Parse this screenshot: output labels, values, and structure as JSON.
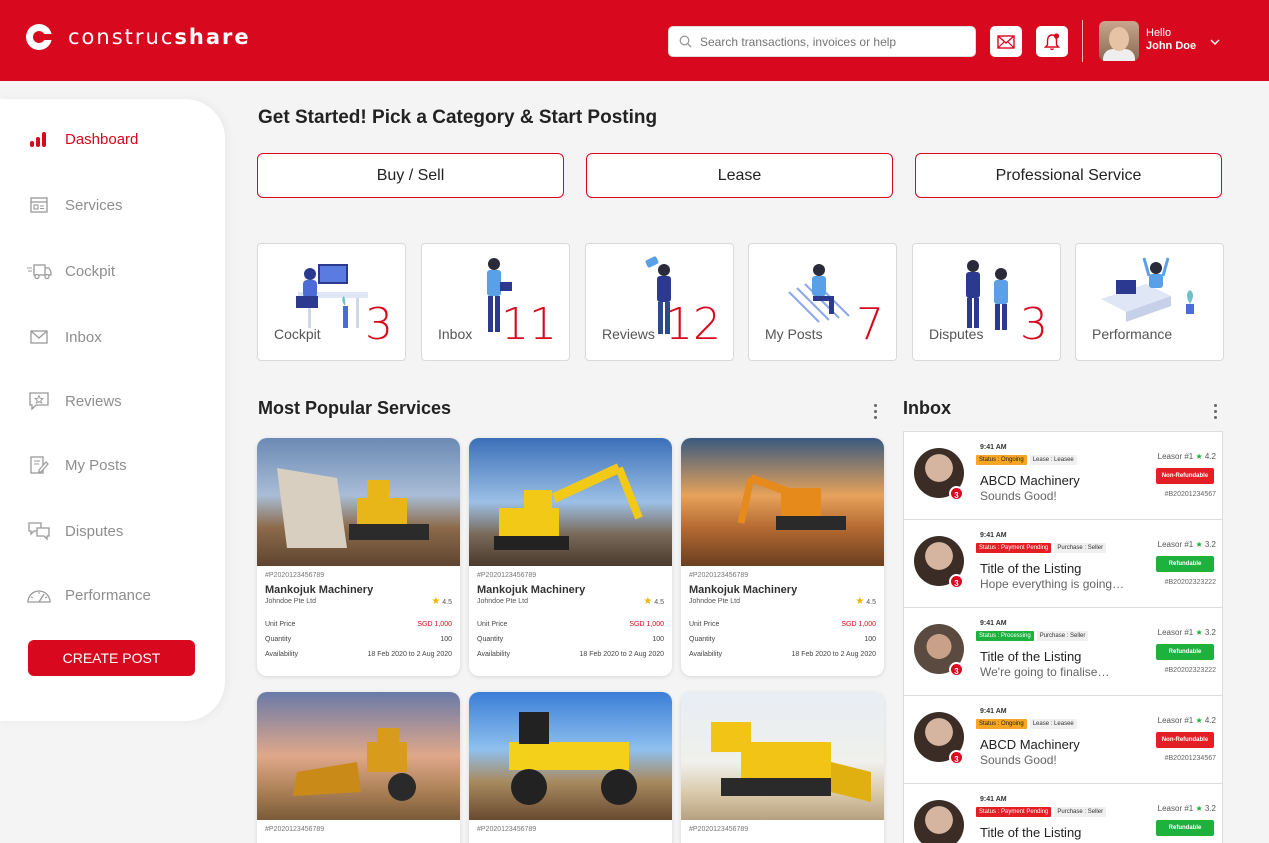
{
  "header": {
    "brand_light": "construc",
    "brand_bold": "share",
    "search_placeholder": "Search transactions, invoices or help",
    "greeting": "Hello",
    "user_name": "John Doe"
  },
  "sidebar": {
    "items": [
      {
        "label": "Dashboard",
        "icon": "bar-chart-icon"
      },
      {
        "label": "Services",
        "icon": "services-icon"
      },
      {
        "label": "Cockpit",
        "icon": "truck-icon"
      },
      {
        "label": "Inbox",
        "icon": "mail-icon"
      },
      {
        "label": "Reviews",
        "icon": "star-chat-icon"
      },
      {
        "label": "My Posts",
        "icon": "edit-icon"
      },
      {
        "label": "Disputes",
        "icon": "chat-bubbles-icon"
      },
      {
        "label": "Performance",
        "icon": "gauge-icon"
      }
    ],
    "create_post": "CREATE POST"
  },
  "main": {
    "title": "Get Started! Pick a Category & Start Posting",
    "categories": [
      "Buy / Sell",
      "Lease",
      "Professional Service"
    ],
    "tiles": [
      {
        "label": "Cockpit",
        "count": "3"
      },
      {
        "label": "Inbox",
        "count": "11"
      },
      {
        "label": "Reviews",
        "count": "12"
      },
      {
        "label": "My Posts",
        "count": "7"
      },
      {
        "label": "Disputes",
        "count": "3"
      },
      {
        "label": "Performance",
        "count": ""
      }
    ],
    "popular_title": "Most Popular Services",
    "inbox_title": "Inbox"
  },
  "services": {
    "cards": [
      {
        "id": "#P2020123456789",
        "title": "Mankojuk Machinery",
        "company": "Johndoe Pte Ltd",
        "rating": "4.5",
        "unit_price_label": "Unit Price",
        "unit_price": "SGD 1,000",
        "quantity_label": "Quantity",
        "quantity": "100",
        "availability_label": "Availability",
        "availability": "18 Feb 2020 to 2 Aug 2020"
      },
      {
        "id": "#P2020123456789",
        "title": "Mankojuk Machinery",
        "company": "Johndoe Pte Ltd",
        "rating": "4.5",
        "unit_price_label": "Unit Price",
        "unit_price": "SGD 1,000",
        "quantity_label": "Quantity",
        "quantity": "100",
        "availability_label": "Availability",
        "availability": "18 Feb 2020 to 2 Aug 2020"
      },
      {
        "id": "#P2020123456789",
        "title": "Mankojuk Machinery",
        "company": "Johndoe Pte Ltd",
        "rating": "4.5",
        "unit_price_label": "Unit Price",
        "unit_price": "SGD 1,000",
        "quantity_label": "Quantity",
        "quantity": "100",
        "availability_label": "Availability",
        "availability": "18 Feb 2020 to 2 Aug 2020"
      }
    ],
    "row2_ids": [
      "#P2020123456789",
      "#P2020123456789",
      "#P2020123456789"
    ]
  },
  "inbox": {
    "messages": [
      {
        "time": "9:41 AM",
        "tag1": "Status : Ongoing",
        "tag1_color": "orange",
        "tag2": "Lease : Leasee",
        "title": "ABCD Machinery",
        "text": "Sounds Good!",
        "lessor": "Leasor #1",
        "rating": "4.2",
        "status": "Non-Refundable",
        "status_color": "red",
        "ref": "#B20201234567",
        "badge": "3"
      },
      {
        "time": "9:41 AM",
        "tag1": "Status : Payment Pending",
        "tag1_color": "red",
        "tag2": "Purchase : Seller",
        "title": "Title of the Listing",
        "text": "Hope everything is going…",
        "lessor": "Leasor #1",
        "rating": "3.2",
        "status": "Refundable",
        "status_color": "green",
        "ref": "#B20202323222",
        "badge": "3"
      },
      {
        "time": "9:41 AM",
        "tag1": "Status : Processing",
        "tag1_color": "green",
        "tag2": "Purchase : Seller",
        "title": "Title of the Listing",
        "text": "We're going to finalise…",
        "lessor": "Leasor #1",
        "rating": "3.2",
        "status": "Refundable",
        "status_color": "green",
        "ref": "#B20202323222",
        "badge": "3"
      },
      {
        "time": "9:41 AM",
        "tag1": "Status : Ongoing",
        "tag1_color": "orange",
        "tag2": "Lease : Leasee",
        "title": "ABCD Machinery",
        "text": "Sounds Good!",
        "lessor": "Leasor #1",
        "rating": "4.2",
        "status": "Non-Refundable",
        "status_color": "red",
        "ref": "#B20201234567",
        "badge": "3"
      },
      {
        "time": "9:41 AM",
        "tag1": "Status : Payment Pending",
        "tag1_color": "red",
        "tag2": "Purchase : Seller",
        "title": "Title of the Listing",
        "text": "",
        "lessor": "Leasor #1",
        "rating": "3.2",
        "status": "Refundable",
        "status_color": "green",
        "ref": "",
        "badge": ""
      }
    ]
  },
  "colors": {
    "brand": "#d8091e",
    "green": "#1db13e",
    "orange": "#f5a623"
  }
}
